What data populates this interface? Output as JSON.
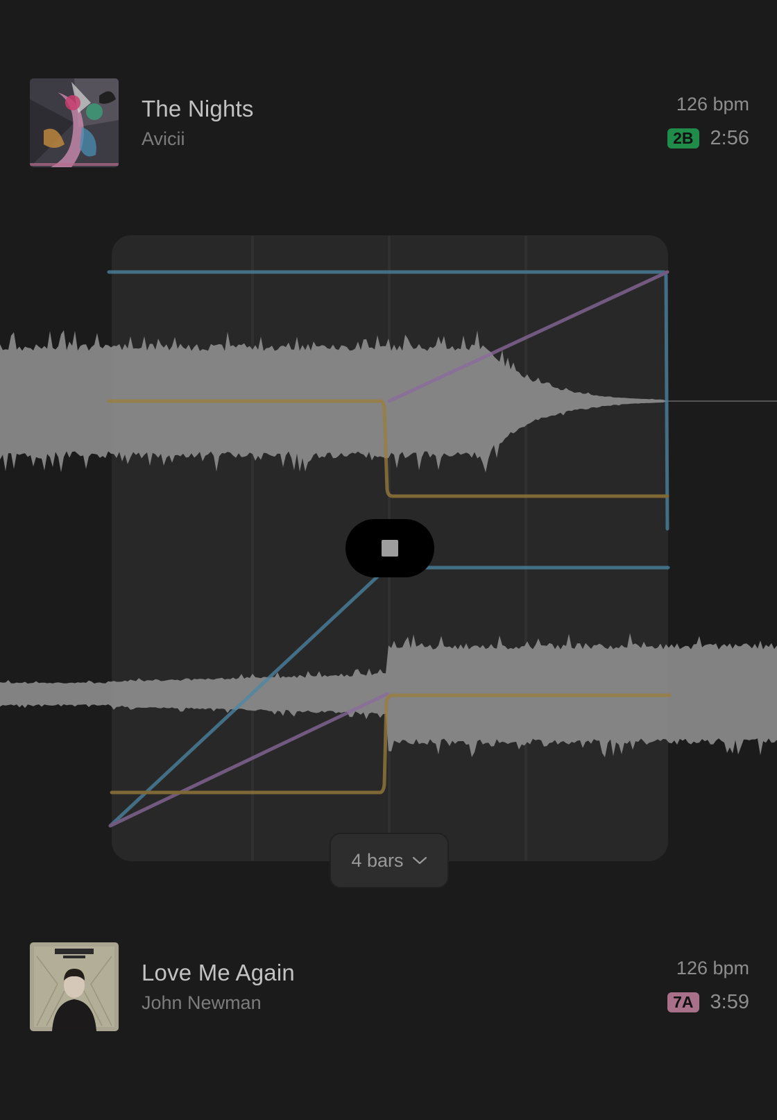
{
  "tracks": [
    {
      "title": "The Nights",
      "artist": "Avicii",
      "bpm": "126 bpm",
      "key": "2B",
      "key_color": "#1f8c4a",
      "duration": "2:56",
      "cover_icon": "album-art-the-nights"
    },
    {
      "title": "Love Me Again",
      "artist": "John Newman",
      "bpm": "126 bpm",
      "key": "7A",
      "key_color": "#a9708a",
      "duration": "3:59",
      "cover_icon": "album-art-love-me-again"
    }
  ],
  "transition": {
    "length_label": "4 bars",
    "stop_icon": "stop-icon",
    "curve_colors": {
      "volume": "#4d87a6",
      "eq": "#8a6a9e",
      "filter": "#9b7e3a"
    },
    "waveform_color": "#9a9a9a"
  }
}
